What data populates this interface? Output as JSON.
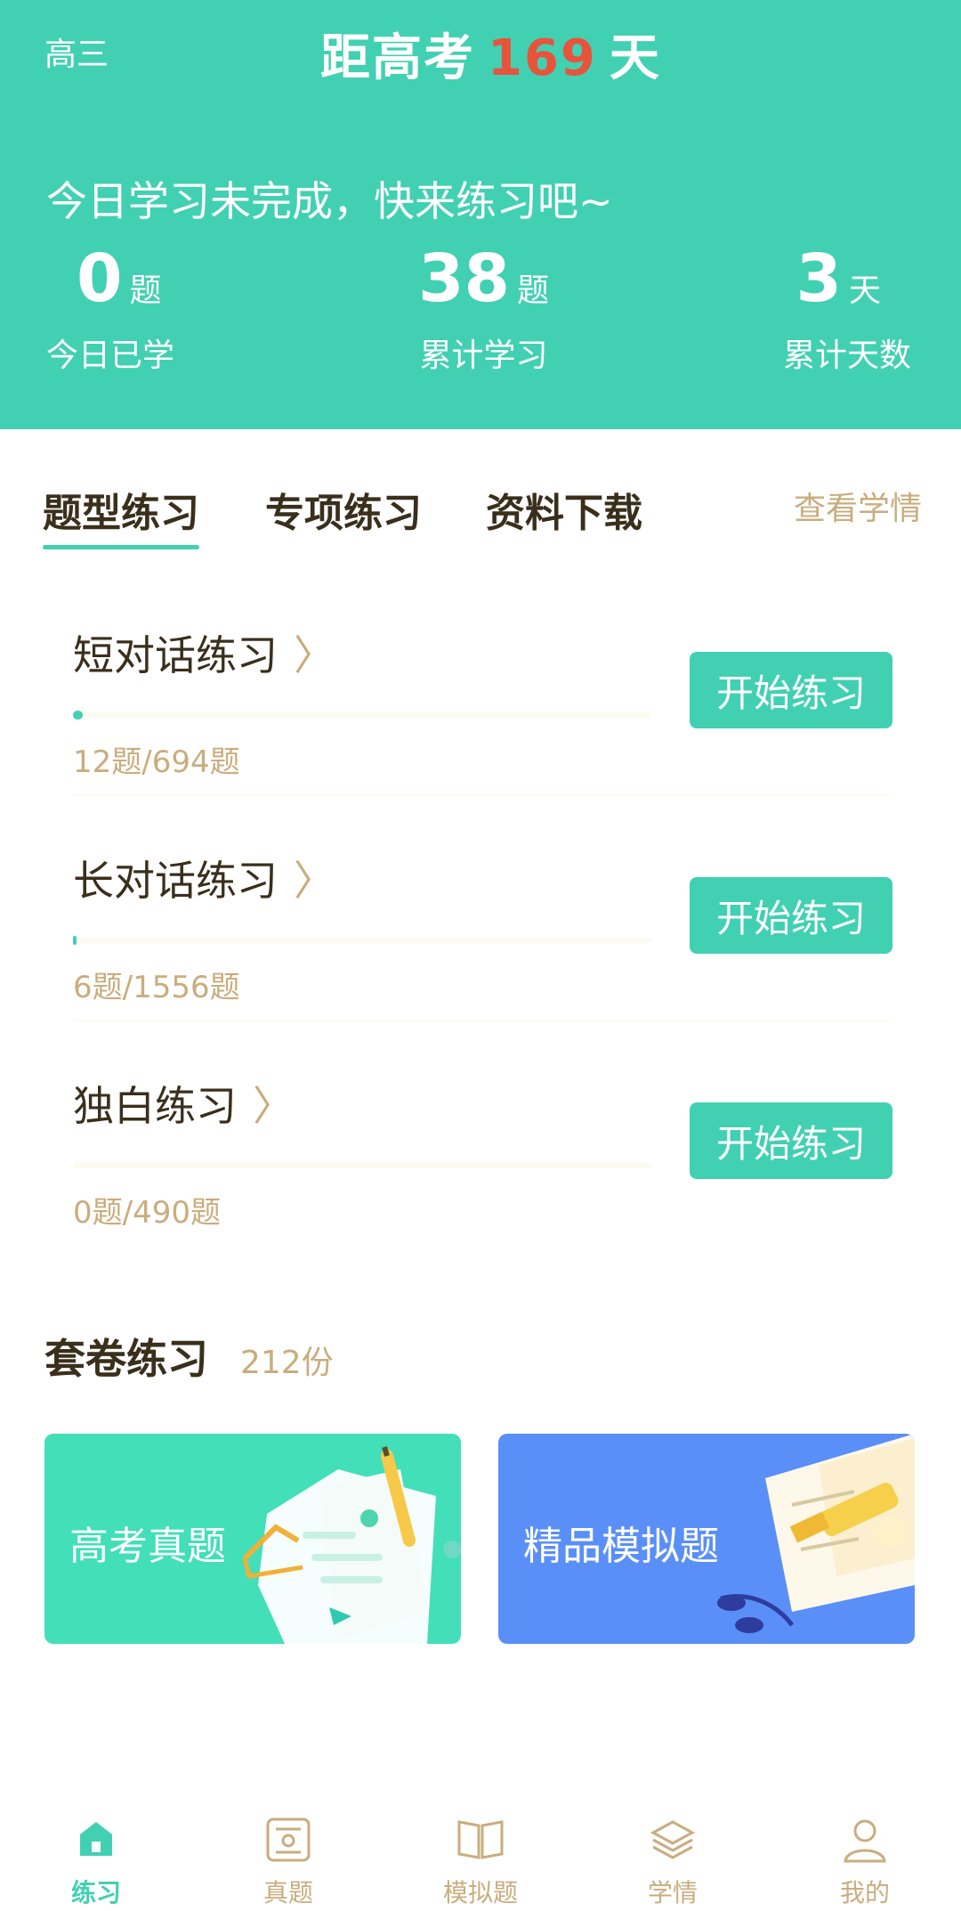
{
  "header": {
    "grade": "高三",
    "countdown_prefix": "距高考",
    "countdown_days": "169",
    "countdown_suffix": "天",
    "prompt": "今日学习未完成，快来练习吧~",
    "stats": [
      {
        "value": "0",
        "unit": "题",
        "label": "今日已学"
      },
      {
        "value": "38",
        "unit": "题",
        "label": "累计学习"
      },
      {
        "value": "3",
        "unit": "天",
        "label": "累计天数"
      }
    ]
  },
  "tabs": {
    "items": [
      "题型练习",
      "专项练习",
      "资料下载"
    ],
    "active": 0,
    "view_progress": "查看学情"
  },
  "practice": [
    {
      "title": "短对话练习",
      "count": "12题/694题",
      "done": 12,
      "total": 694,
      "button": "开始练习"
    },
    {
      "title": "长对话练习",
      "count": "6题/1556题",
      "done": 6,
      "total": 1556,
      "button": "开始练习"
    },
    {
      "title": "独白练习",
      "count": "0题/490题",
      "done": 0,
      "total": 490,
      "button": "开始练习"
    }
  ],
  "papers": {
    "title": "套卷练习",
    "count": "212份",
    "cards": [
      {
        "label": "高考真题",
        "color": "#42dfb8"
      },
      {
        "label": "精品模拟题",
        "color": "#5a8ff8"
      }
    ]
  },
  "tabbar": {
    "items": [
      {
        "label": "练习",
        "icon": "home-icon"
      },
      {
        "label": "真题",
        "icon": "exam-paper-icon"
      },
      {
        "label": "模拟题",
        "icon": "open-book-icon"
      },
      {
        "label": "学情",
        "icon": "layers-icon"
      },
      {
        "label": "我的",
        "icon": "user-icon"
      }
    ],
    "active": 0
  },
  "colors": {
    "accent": "#42d0b2",
    "countdown_number": "#e8533b",
    "muted_text": "#c9ad7e",
    "card_mock": "#5a8ff8"
  }
}
